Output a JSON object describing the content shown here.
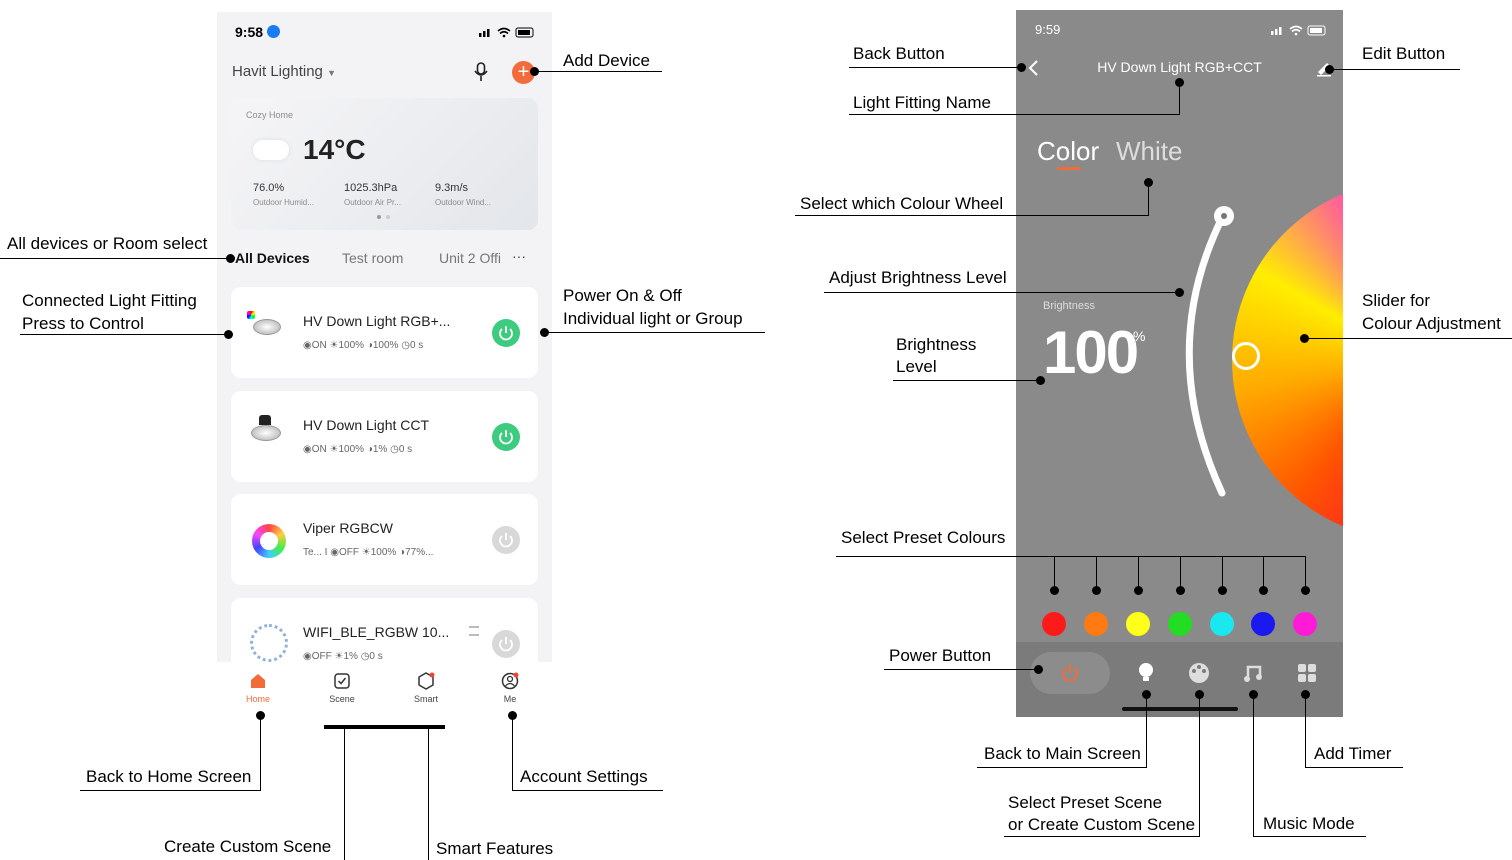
{
  "phone1": {
    "status_time": "9:58",
    "home_name": "Havit Lighting",
    "weather": {
      "home_label": "Cozy Home",
      "temperature": "14°C",
      "stats": [
        {
          "value": "76.0%",
          "label": "Outdoor Humid..."
        },
        {
          "value": "1025.3hPa",
          "label": "Outdoor Air Pr..."
        },
        {
          "value": "9.3m/s",
          "label": "Outdoor Wind..."
        }
      ]
    },
    "rooms": [
      "All Devices",
      "Test room",
      "Unit 2 Offi"
    ],
    "more_glyph": "···",
    "devices": [
      {
        "name": "HV  Down Light  RGB+...",
        "status": "◉ON  ☀100%  ◑100%  ◷0 s",
        "on": true
      },
      {
        "name": "HV  Down Light  CCT",
        "status": "◉ON  ☀100%  ◑1%  ◷0 s",
        "on": true
      },
      {
        "name": "Viper RGBCW",
        "status": "Te...  I  ◉OFF  ☀100%  ◑77%...",
        "on": false
      },
      {
        "name": "WIFI_BLE_RGBW 10...",
        "status": "◉OFF  ☀1%  ◷0 s",
        "on": false
      }
    ],
    "tabbar": [
      "Home",
      "Scene",
      "Smart",
      "Me"
    ],
    "accent": "#f26b3a",
    "on_color": "#3ccb7f"
  },
  "phone2": {
    "status_time": "9:59",
    "title": "HV  Down Light  RGB+CCT",
    "modes": [
      "Color",
      "White"
    ],
    "brightness_label": "Brightness",
    "brightness_value": "100",
    "brightness_unit": "%",
    "preset_colors": [
      "#ff1a1a",
      "#ff7a12",
      "#ffff1a",
      "#22dd22",
      "#1ae8f0",
      "#1a1aee",
      "#ff1ad8"
    ]
  },
  "annotations": {
    "add_device": "Add Device",
    "room_select": "All devices or Room select",
    "connected_1": "Connected Light Fitting",
    "connected_2": "Press to Control",
    "power_1": "Power On & Off",
    "power_2": "Individual light or Group",
    "home_screen": "Back to Home Screen",
    "account": "Account Settings",
    "custom_scene": "Create Custom Scene",
    "smart": "Smart Features",
    "back_button": "Back Button",
    "edit_button": "Edit Button",
    "fitting_name": "Light Fitting Name",
    "colour_wheel": "Select which Colour Wheel",
    "adjust_brightness": "Adjust Brightness Level",
    "slider_1": "Slider for",
    "slider_2": "Colour Adjustment",
    "brightness_1": "Brightness",
    "brightness_2": "Level",
    "preset_colours": "Select Preset Colours",
    "power_button": "Power Button",
    "main_screen": "Back to Main Screen",
    "preset_scene_1": "Select Preset Scene",
    "preset_scene_2": "or Create Custom Scene",
    "music": "Music Mode",
    "timer": "Add Timer"
  }
}
